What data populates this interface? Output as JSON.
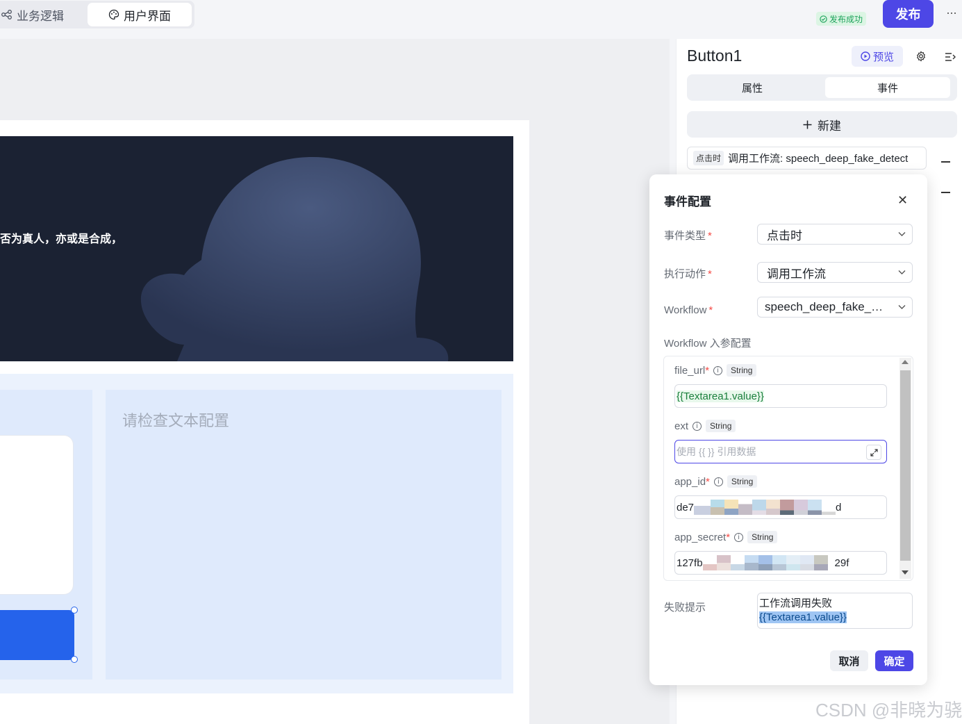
{
  "topbar": {
    "tabs": [
      {
        "label": "业务逻辑",
        "icon": "workflow-icon"
      },
      {
        "label": "用户界面",
        "icon": "palette-icon"
      }
    ],
    "status_badge": "发布成功",
    "publish_label": "发布",
    "more_label": "···"
  },
  "canvas": {
    "hero_text": "否为真人，亦或是合成，",
    "placeholder_text": "请检查文本配置"
  },
  "panel": {
    "title": "Button1",
    "preview_label": "预览",
    "segments": [
      "属性",
      "事件"
    ],
    "active_segment": "事件",
    "new_label": "新建",
    "event": {
      "tag": "点击时",
      "text": "调用工作流: speech_deep_fake_detect"
    }
  },
  "modal": {
    "title": "事件配置",
    "fields": {
      "event_type_label": "事件类型",
      "event_type_value": "点击时",
      "action_label": "执行动作",
      "action_value": "调用工作流",
      "workflow_label": "Workflow",
      "workflow_value": "speech_deep_fake_…"
    },
    "params_label": "Workflow 入参配置",
    "params": [
      {
        "name": "file_url",
        "required": "*",
        "type": "String",
        "value_hl": "{{Textarea1.value}}"
      },
      {
        "name": "ext",
        "required": "",
        "type": "String",
        "placeholder": "使用 {{ }} 引用数据"
      },
      {
        "name": "app_id",
        "required": "*",
        "type": "String",
        "prefix": "de7",
        "suffix": "d"
      },
      {
        "name": "app_secret",
        "required": "*",
        "type": "String",
        "prefix": "127fb",
        "suffix": "29f"
      }
    ],
    "fail_label": "失败提示",
    "fail_text": "工作流调用失败",
    "fail_ref": "{{Textarea1.value}}",
    "cancel_label": "取消",
    "ok_label": "确定"
  },
  "watermark": "CSDN @非晓为骁",
  "colors": {
    "accent": "#4d47e6",
    "success": "#1ea35b",
    "hero_bg": "#1b2233",
    "selection": "#2563eb"
  }
}
